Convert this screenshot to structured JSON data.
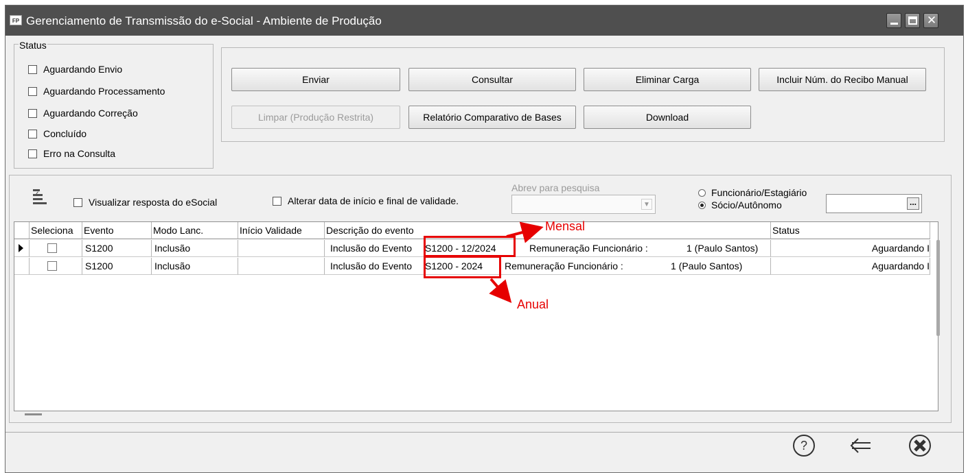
{
  "window": {
    "icon_label": "FP",
    "title": "Gerenciamento de Transmissão do e-Social - Ambiente de Produção",
    "controls": {
      "minimize": "minimize",
      "maximize": "maximize",
      "close": "✕"
    }
  },
  "status_filter": {
    "legend": "Status",
    "options": [
      {
        "label": "Aguardando Envio",
        "checked": false
      },
      {
        "label": "Aguardando Processamento",
        "checked": false
      },
      {
        "label": "Aguardando Correção",
        "checked": false
      },
      {
        "label": "Concluído",
        "checked": false
      },
      {
        "label": "Erro na Consulta",
        "checked": false
      }
    ]
  },
  "actions": {
    "enviar": "Enviar",
    "consultar": "Consultar",
    "eliminar_carga": "Eliminar Carga",
    "incluir_recibo": "Incluir Núm. do Recibo Manual",
    "limpar": "Limpar (Produção Restrita)",
    "relatorio": "Relatório Comparativo de Bases",
    "download": "Download"
  },
  "filters": {
    "visualizar_resposta": "Visualizar resposta do eSocial",
    "alterar_data": "Alterar data de início e final de validade.",
    "abrev_label": "Abrev para pesquisa",
    "abrev_value": "",
    "radio_funcionario": "Funcionário/Estagiário",
    "radio_socio": "Sócio/Autônomo",
    "selected_radio": "Sócio/Autônomo",
    "lookup_value": "",
    "lookup_button": "..."
  },
  "table": {
    "columns": [
      "Seleciona",
      "Evento",
      "Modo Lanc.",
      "Início Validade",
      "Descrição do evento",
      "Status"
    ],
    "rows": [
      {
        "selected": false,
        "evento": "S1200",
        "modo": "Inclusão",
        "inicio_validade": "",
        "descricao_prefix": "Inclusão do Evento",
        "descricao_code": "S1200 - 12/2024",
        "descricao_tipo": "Remuneração Funcionário :",
        "descricao_pessoa": "1 (Paulo Santos)",
        "status": "Aguardando I"
      },
      {
        "selected": false,
        "evento": "S1200",
        "modo": "Inclusão",
        "inicio_validade": "",
        "descricao_prefix": "Inclusão do Evento",
        "descricao_code": "S1200 - 2024",
        "descricao_tipo": "Remuneração Funcionário :",
        "descricao_pessoa": "1 (Paulo Santos)",
        "status": "Aguardando I"
      }
    ]
  },
  "annotations": {
    "mensal": "Mensal",
    "anual": "Anual",
    "color": "#e60000"
  },
  "footer": {
    "help_icon": "help-icon",
    "back_icon": "back-arrow-icon",
    "close_icon": "close-circle-icon"
  }
}
